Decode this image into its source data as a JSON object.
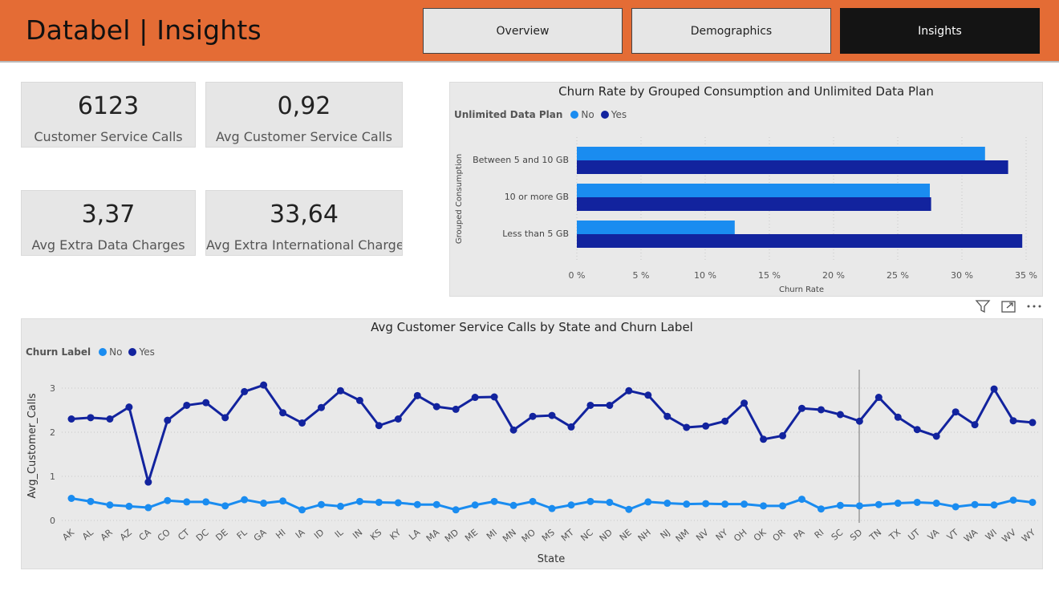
{
  "header": {
    "title": "Databel | Insights",
    "nav": [
      {
        "label": "Overview",
        "active": false
      },
      {
        "label": "Demographics",
        "active": false
      },
      {
        "label": "Insights",
        "active": true
      }
    ]
  },
  "kpis": [
    {
      "value": "6123",
      "label": "Customer Service Calls"
    },
    {
      "value": "0,92",
      "label": "Avg Customer Service Calls"
    },
    {
      "value": "3,37",
      "label": "Avg Extra Data Charges"
    },
    {
      "value": "33,64",
      "label": "Avg Extra International Charges"
    }
  ],
  "colors": {
    "no": "#1a8cf0",
    "yes": "#12239e",
    "accent": "#e46c35"
  },
  "toolbar_icons": [
    "filter-icon",
    "focus-mode-icon",
    "more-options-icon"
  ],
  "bar_panel": {
    "title": "Churn Rate by Grouped Consumption and Unlimited Data Plan",
    "legend_title": "Unlimited Data Plan",
    "legend_items": [
      "No",
      "Yes"
    ],
    "chart_data": {
      "type": "bar",
      "orientation": "horizontal",
      "title": "Churn Rate by Grouped Consumption and Unlimited Data Plan",
      "xlabel": "Churn Rate",
      "ylabel": "Grouped Consumption",
      "categories": [
        "Between 5 and 10 GB",
        "10 or more GB",
        "Less than 5 GB"
      ],
      "series": [
        {
          "name": "No",
          "values": [
            31.8,
            27.5,
            12.3
          ]
        },
        {
          "name": "Yes",
          "values": [
            33.6,
            27.6,
            34.7
          ]
        }
      ],
      "xlim": [
        0,
        35
      ],
      "xticks": [
        "0 %",
        "5 %",
        "10 %",
        "15 %",
        "20 %",
        "25 %",
        "30 %",
        "35 %"
      ],
      "grid": true,
      "legend": "top-left"
    }
  },
  "line_panel": {
    "title": "Avg Customer Service Calls by State and Churn Label",
    "legend_title": "Churn Label",
    "legend_items": [
      "No",
      "Yes"
    ],
    "chart_data": {
      "type": "line",
      "title": "Avg Customer Service Calls by State and Churn Label",
      "xlabel": "State",
      "ylabel": "Avg_Customer_Calls",
      "categories": [
        "AK",
        "AL",
        "AR",
        "AZ",
        "CA",
        "CO",
        "CT",
        "DC",
        "DE",
        "FL",
        "GA",
        "HI",
        "IA",
        "ID",
        "IL",
        "IN",
        "KS",
        "KY",
        "LA",
        "MA",
        "MD",
        "ME",
        "MI",
        "MN",
        "MO",
        "MS",
        "MT",
        "NC",
        "ND",
        "NE",
        "NH",
        "NJ",
        "NM",
        "NV",
        "NY",
        "OH",
        "OK",
        "OR",
        "PA",
        "RI",
        "SC",
        "SD",
        "TN",
        "TX",
        "UT",
        "VA",
        "VT",
        "WA",
        "WI",
        "WV",
        "WY"
      ],
      "series": [
        {
          "name": "No",
          "values": [
            0.5,
            0.43,
            0.35,
            0.32,
            0.29,
            0.45,
            0.42,
            0.42,
            0.33,
            0.47,
            0.39,
            0.44,
            0.24,
            0.36,
            0.32,
            0.43,
            0.41,
            0.4,
            0.36,
            0.36,
            0.24,
            0.35,
            0.43,
            0.34,
            0.43,
            0.27,
            0.35,
            0.43,
            0.41,
            0.25,
            0.42,
            0.39,
            0.37,
            0.38,
            0.37,
            0.37,
            0.33,
            0.33,
            0.48,
            0.26,
            0.34,
            0.33,
            0.36,
            0.39,
            0.41,
            0.39,
            0.31,
            0.36,
            0.35,
            0.46,
            0.41
          ]
        },
        {
          "name": "Yes",
          "values": [
            2.3,
            2.33,
            2.3,
            2.57,
            0.87,
            2.27,
            2.61,
            2.67,
            2.33,
            2.92,
            3.07,
            2.44,
            2.21,
            2.56,
            2.94,
            2.72,
            2.15,
            2.3,
            2.83,
            2.58,
            2.52,
            2.79,
            2.8,
            2.05,
            2.36,
            2.38,
            2.12,
            2.61,
            2.61,
            2.94,
            2.84,
            2.36,
            2.11,
            2.14,
            2.25,
            2.66,
            1.84,
            1.92,
            2.54,
            2.51,
            2.4,
            2.25,
            2.79,
            2.34,
            2.06,
            1.91,
            2.46,
            2.17,
            2.98,
            2.26,
            2.22
          ]
        }
      ],
      "ylim": [
        0,
        3.2
      ],
      "yticks": [
        "0",
        "1",
        "2",
        "3"
      ],
      "grid": true,
      "legend": "top-left"
    }
  }
}
